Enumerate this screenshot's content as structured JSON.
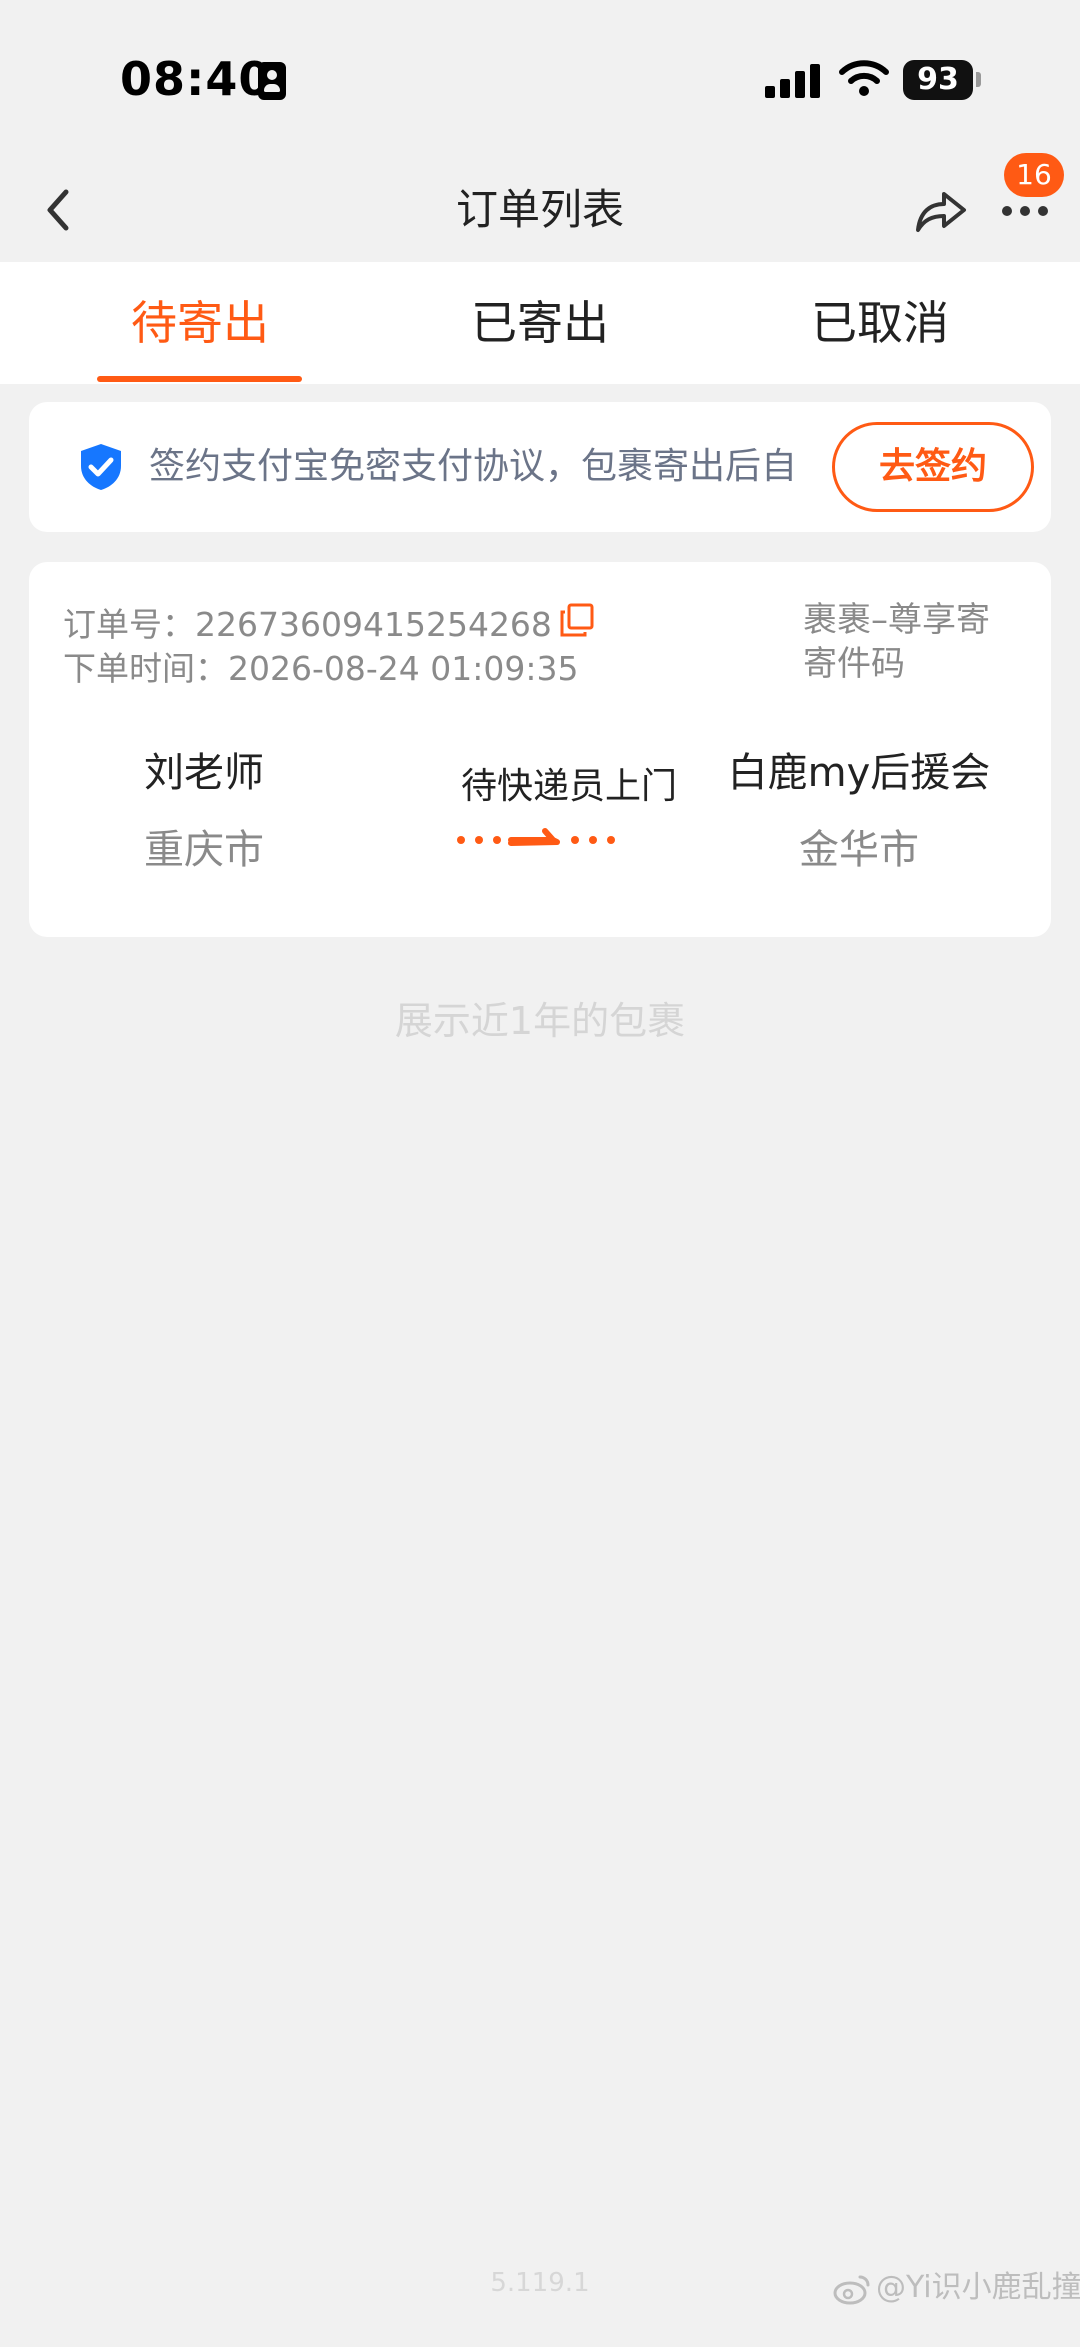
{
  "status_bar": {
    "time": "08:40",
    "battery": "93"
  },
  "nav": {
    "title": "订单列表",
    "badge": "16"
  },
  "tabs": [
    {
      "label": "待寄出",
      "active": true
    },
    {
      "label": "已寄出",
      "active": false
    },
    {
      "label": "已取消",
      "active": false
    }
  ],
  "banner": {
    "text": "签约支付宝免密支付协议，包裹寄出后自",
    "button": "去签约"
  },
  "order": {
    "order_no": "订单号：22673609415254268",
    "order_time": "下单时间：2026-08-24 01:09:35",
    "service": "裹裹–尊享寄寄件码",
    "sender_name": "刘老师",
    "sender_city": "重庆市",
    "status": "待快递员上门",
    "receiver_name": "白鹿my后援会",
    "receiver_city": "金华市"
  },
  "footer_note": "展示近1年的包裹",
  "version": "5.119.1",
  "watermark": "@Yi识小鹿乱撞",
  "colors": {
    "accent": "#ff5a14",
    "shield": "#1677ff",
    "background": "#f1f1f1"
  }
}
